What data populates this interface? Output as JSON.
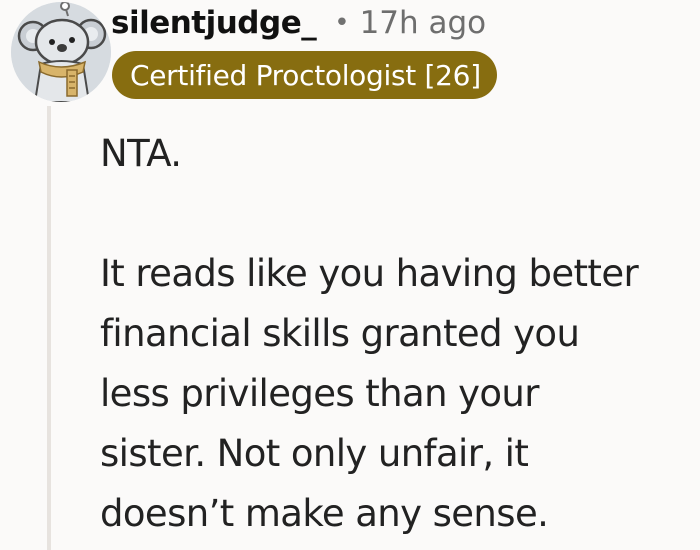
{
  "comment": {
    "username": "silentjudge_",
    "separator": "•",
    "timestamp": "17h ago",
    "flair": "Certified Proctologist [26]",
    "avatar_icon": "koala-avatar-icon",
    "paragraphs": [
      "NTA.",
      "It reads like you having better\nfinancial skills granted you\nless privileges than your\nsister. Not only unfair, it\ndoesn’t make any sense."
    ]
  },
  "colors": {
    "flair_background": "#876d10",
    "username": "#111111",
    "timestamp": "#6e6e6e",
    "body_text": "#222222",
    "background": "#fbfaf9"
  }
}
